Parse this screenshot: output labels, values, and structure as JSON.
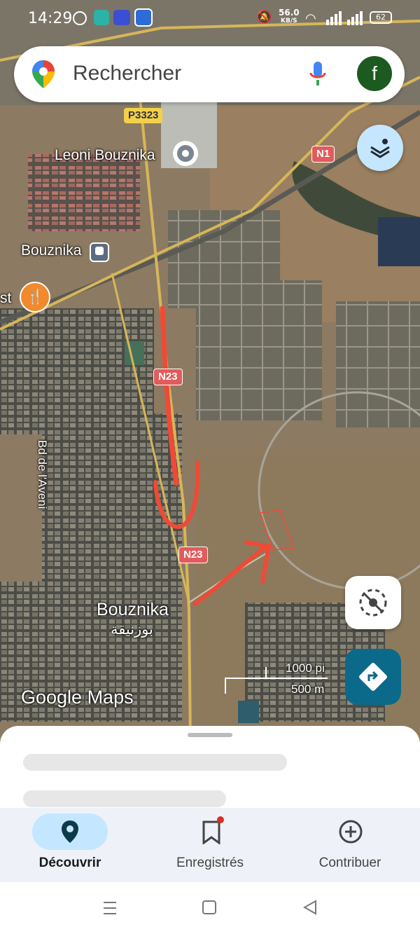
{
  "status_bar": {
    "time": "14:29",
    "net_speed": "56.0",
    "net_unit": "KB/S",
    "battery": "62"
  },
  "search": {
    "placeholder": "Rechercher",
    "avatar_letter": "f"
  },
  "map": {
    "labels": {
      "poi_leoni": "Leoni Bouznika",
      "station": "Bouznika",
      "restaurant_partial": "st",
      "street": "Bd de l'Aveni",
      "city": "Bouznika",
      "city_arabic": "بوزنيقة"
    },
    "road_badges": {
      "p3323": "P3323",
      "n1": "N1",
      "n23_top": "N23",
      "n23_bottom": "N23"
    },
    "scale": {
      "feet": "1000 pi",
      "meters": "500 m"
    },
    "brand": "Google Maps"
  },
  "bottom_nav": {
    "items": [
      {
        "label": "Découvrir",
        "icon": "place-pin-icon",
        "active": true
      },
      {
        "label": "Enregistrés",
        "icon": "bookmark-icon",
        "active": false
      },
      {
        "label": "Contribuer",
        "icon": "add-circle-icon",
        "active": false
      }
    ]
  },
  "colors": {
    "accent_teal": "#0b6a8a",
    "active_pill": "#c4e7ff",
    "badge_red": "#e25b5b",
    "annotation_red": "#f04a36"
  }
}
